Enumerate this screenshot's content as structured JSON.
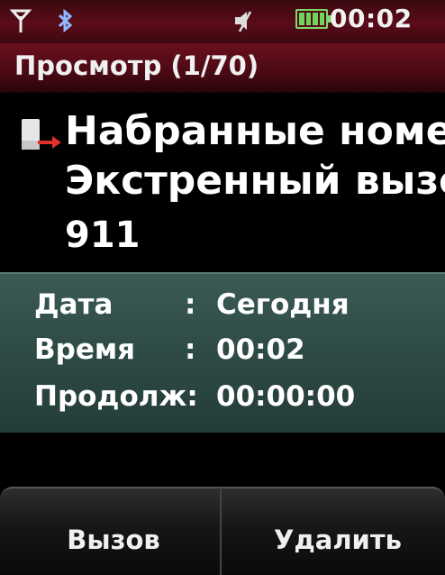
{
  "status_bar": {
    "time": "00:02",
    "icons": [
      "signal-icon",
      "bluetooth-icon",
      "mute-icon",
      "battery-icon"
    ],
    "battery_color": "#6fd45a"
  },
  "title_bar": {
    "title": "Просмотр (1/70)"
  },
  "call": {
    "type_icon": "outgoing-call-icon",
    "type": "Набранные номер",
    "name": "Экстренный вызо",
    "number": "911"
  },
  "details": {
    "date_label": "Дата",
    "date_value": "Сегодня",
    "time_label": "Время",
    "time_value": "00:02",
    "duration_label": "Продолж:",
    "duration_value": "00:00:00"
  },
  "softkeys": {
    "left": "Вызов",
    "right": "Удалить"
  },
  "colors": {
    "header_red": "#5a0c18",
    "panel_teal": "#2e4a45"
  }
}
